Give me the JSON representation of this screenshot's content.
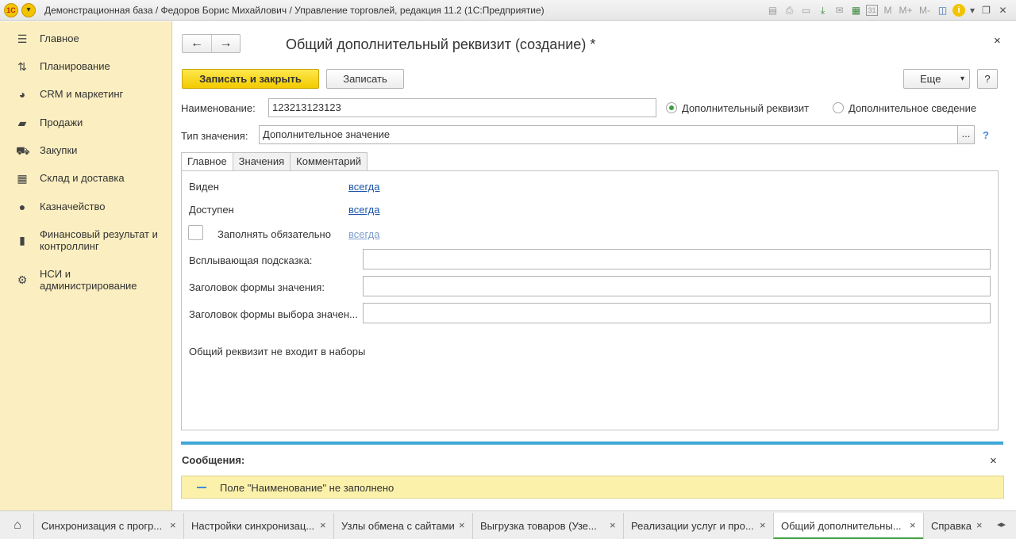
{
  "titlebar": {
    "logo": "1C",
    "menu_icon": "▾",
    "title": "Демонстрационная база / Федоров Борис Михайлович / Управление торговлей, редакция 11.2  (1С:Предприятие)",
    "icons": [
      "save-icon",
      "print-icon",
      "preview-icon",
      "download-icon",
      "mail-icon",
      "calculator-icon",
      "calendar-icon",
      "memory-m-icon",
      "memory-m-plus-icon",
      "memory-m-minus-icon",
      "panel-icon",
      "info-icon",
      "dropdown-icon",
      "restore-icon",
      "close-icon"
    ],
    "calendar_day": "31",
    "m_label": "M",
    "m_plus_label": "M+",
    "m_minus_label": "M-"
  },
  "sidebar": {
    "items": [
      {
        "label": "Главное",
        "icon": "menu-lines-icon"
      },
      {
        "label": "Планирование",
        "icon": "planning-icon"
      },
      {
        "label": "CRM и маркетинг",
        "icon": "pie-chart-icon"
      },
      {
        "label": "Продажи",
        "icon": "shopping-bag-icon"
      },
      {
        "label": "Закупки",
        "icon": "cart-icon"
      },
      {
        "label": "Склад и доставка",
        "icon": "warehouse-grid-icon"
      },
      {
        "label": "Казначейство",
        "icon": "coin-icon"
      },
      {
        "label": "Финансовый результат и контроллинг",
        "icon": "bar-chart-icon"
      },
      {
        "label": "НСИ и администрирование",
        "icon": "gear-icon"
      }
    ]
  },
  "form": {
    "title": "Общий дополнительный реквизит (создание) *",
    "nav_back": "←",
    "nav_forward": "→",
    "close": "×",
    "buttons": {
      "save_close": "Записать и закрыть",
      "save": "Записать",
      "more": "Еще",
      "more_arrow": "▾",
      "help": "?"
    },
    "name_label": "Наименование:",
    "name_value": "123213123123",
    "radio_attribute": "Дополнительный реквизит",
    "radio_info": "Дополнительное сведение",
    "type_label": "Тип значения:",
    "type_value": "Дополнительное значение",
    "type_select": "...",
    "type_help": "?",
    "tabs": [
      "Главное",
      "Значения",
      "Комментарий"
    ],
    "main_tab": {
      "visible_label": "Виден",
      "visible_value": "всегда",
      "available_label": "Доступен",
      "available_value": "всегда",
      "required_label": "Заполнять обязательно",
      "required_value": "всегда",
      "tooltip_label": "Всплывающая подсказка:",
      "tooltip_value": "",
      "value_form_title_label": "Заголовок формы значения:",
      "value_form_title_value": "",
      "choice_form_title_label": "Заголовок формы выбора значен...",
      "choice_form_title_value": "",
      "sets_note": "Общий реквизит не входит в наборы"
    }
  },
  "messages": {
    "title": "Сообщения:",
    "close": "×",
    "items": [
      "Поле \"Наименование\" не заполнено"
    ]
  },
  "taskbar": {
    "home_icon": "home-icon",
    "tabs": [
      {
        "label": "Синхронизация с прогр...",
        "close": "×"
      },
      {
        "label": "Настройки синхронизац...",
        "close": "×"
      },
      {
        "label": "Узлы обмена с сайтами",
        "close": "×"
      },
      {
        "label": "Выгрузка товаров (Узе...",
        "close": "×"
      },
      {
        "label": "Реализации услуг и про...",
        "close": "×"
      },
      {
        "label": "Общий дополнительны...",
        "close": "×"
      },
      {
        "label": "Справка",
        "close": "×"
      }
    ],
    "active_tab": "Общий дополнительны..."
  },
  "colors": {
    "sidebar_bg": "#fbeec0",
    "primary_button": "#f2ca00",
    "message_bg": "#fbf1ab",
    "separator": "#3fa8d6",
    "link": "#1c55a8",
    "radio_selected": "#3f9f3f"
  }
}
